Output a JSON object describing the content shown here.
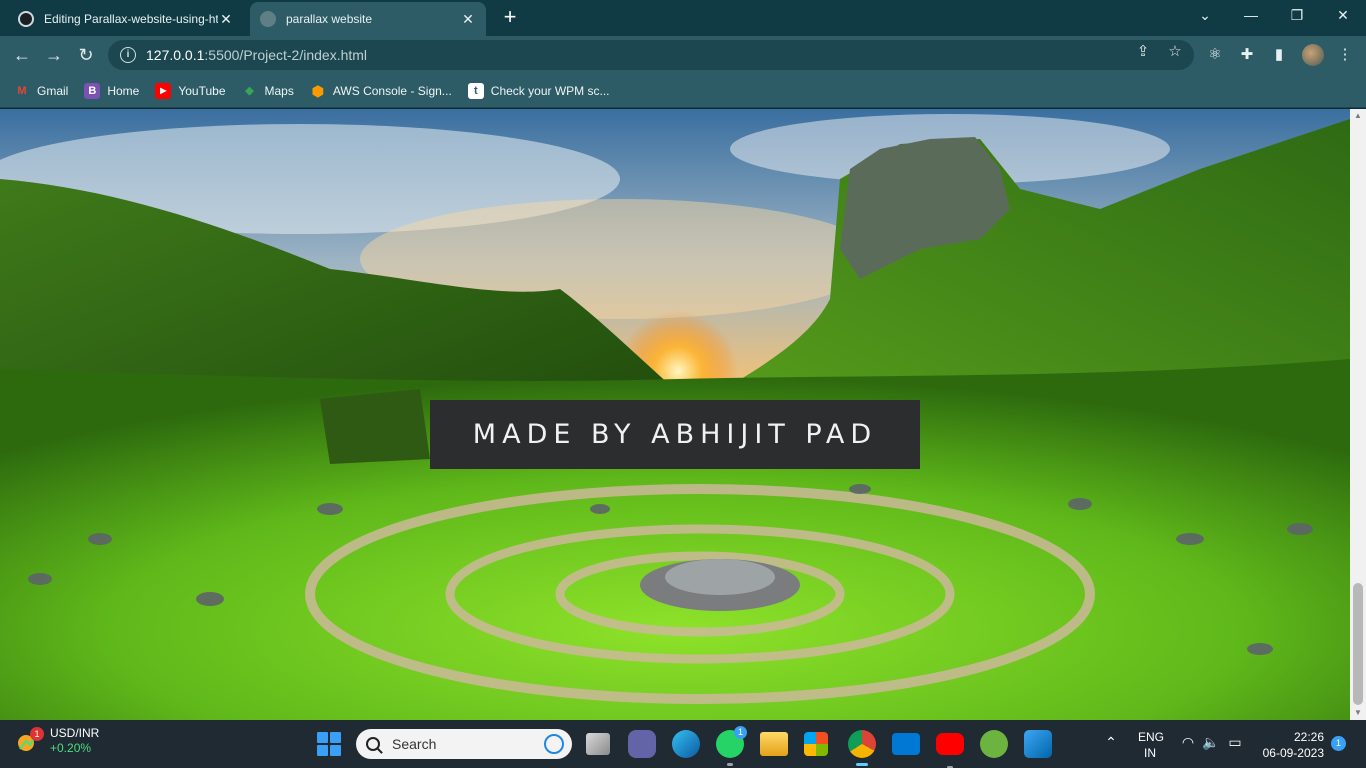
{
  "browser": {
    "tabs": [
      {
        "title": "Editing Parallax-website-using-ht",
        "active": false
      },
      {
        "title": "parallax website",
        "active": true
      }
    ],
    "url_host": "127.0.0.1",
    "url_path": ":5500/Project-2/index.html",
    "bookmarks": [
      {
        "label": "Gmail",
        "icon": "gmail-icon",
        "color": "#ea4335",
        "glyph": "M"
      },
      {
        "label": "Home",
        "icon": "bootstrap-icon",
        "color": "#7952b3",
        "glyph": "B"
      },
      {
        "label": "YouTube",
        "icon": "youtube-icon",
        "color": "#ff0000",
        "glyph": "▶"
      },
      {
        "label": "Maps",
        "icon": "maps-icon",
        "color": "#34a853",
        "glyph": "◆"
      },
      {
        "label": "AWS Console - Sign...",
        "icon": "aws-icon",
        "color": "#ff9900",
        "glyph": "⬢"
      },
      {
        "label": "Check your WPM sc...",
        "icon": "typing-site-icon",
        "color": "#ffffff",
        "glyph": "t"
      }
    ]
  },
  "page": {
    "banner_text": "MADE BY ABHIJIT PAD"
  },
  "taskbar": {
    "widget_title": "USD/INR",
    "widget_value": "+0.20%",
    "widget_badge": "1",
    "search_label": "Search",
    "whatsapp_badge": "1",
    "language_1": "ENG",
    "language_2": "IN",
    "time": "22:26",
    "date": "06-09-2023",
    "notification_count": "1"
  }
}
